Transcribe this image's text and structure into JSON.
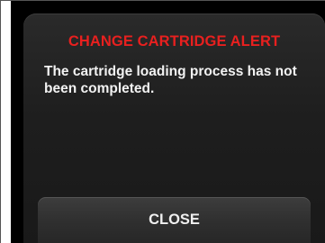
{
  "dialog": {
    "title": "CHANGE CARTRIDGE ALERT",
    "message": "The cartridge loading process has not been completed.",
    "close_label": "CLOSE"
  },
  "colors": {
    "title": "#e8201f",
    "text": "#f2f2f2",
    "panel": "#1e1e1e",
    "button": "#333333",
    "background": "#000000"
  }
}
